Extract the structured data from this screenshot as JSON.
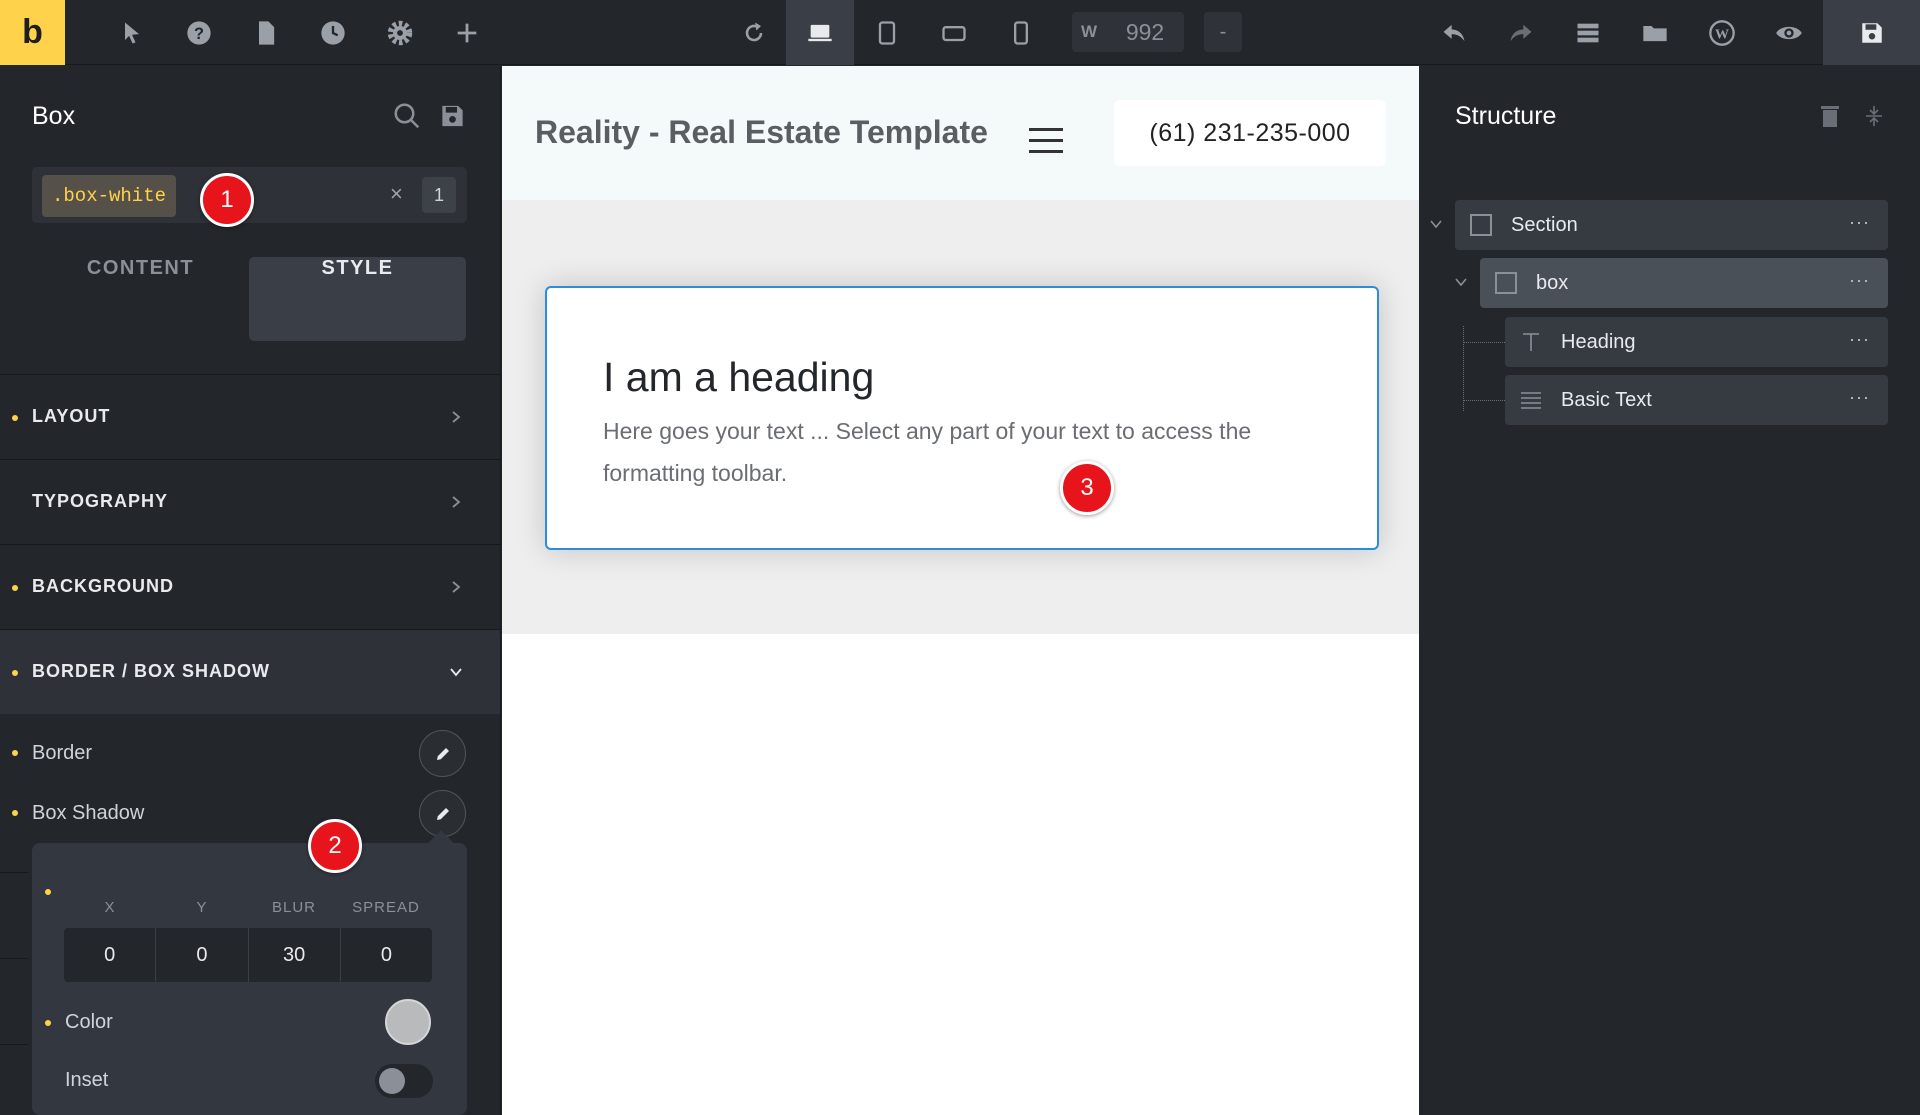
{
  "topbar": {
    "logo": "b",
    "width_label": "W",
    "width_value": "992",
    "dash": "-"
  },
  "left_panel": {
    "title": "Box",
    "class_tag": ".box-white",
    "class_count": "1",
    "clear": "×",
    "tabs": [
      "CONTENT",
      "STYLE"
    ],
    "sections": [
      "LAYOUT",
      "TYPOGRAPHY",
      "BACKGROUND",
      "BORDER / BOX SHADOW"
    ],
    "props": [
      "Border",
      "Box Shadow"
    ],
    "shadow": {
      "headers": [
        "X",
        "Y",
        "BLUR",
        "SPREAD"
      ],
      "values": [
        "0",
        "0",
        "30",
        "0"
      ],
      "color_label": "Color",
      "color_value": "#b9babc",
      "inset_label": "Inset",
      "inset_on": false
    }
  },
  "canvas": {
    "site_title": "Reality - Real Estate Template",
    "phone": "(61) 231-235-000",
    "heading": "I am a heading",
    "text": "Here goes your text ... Select any part of your text to access the formatting toolbar."
  },
  "structure": {
    "title": "Structure",
    "items": [
      "Section",
      "box",
      "Heading",
      "Basic Text"
    ],
    "more": "···"
  },
  "markers": [
    "1",
    "2",
    "3"
  ],
  "colors": {
    "accent": "#ffd24b",
    "selection": "#2a8fd8",
    "marker": "#e8141c"
  }
}
